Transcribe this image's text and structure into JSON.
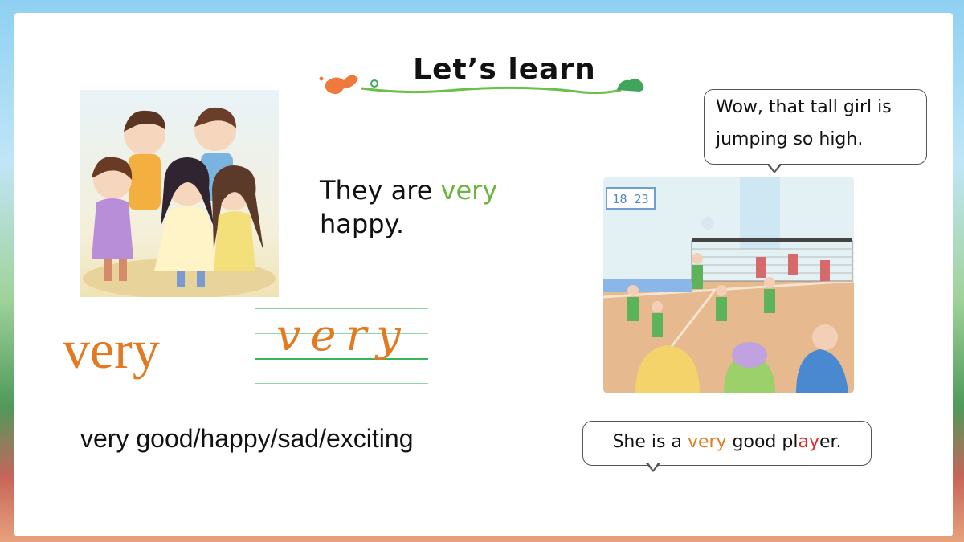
{
  "title": "Let’s learn",
  "sentence1": {
    "before": "They are ",
    "highlight": "very",
    "after": " happy."
  },
  "word_big": "very",
  "word_handwriting": "very",
  "phrases": "very good/happy/sad/exciting",
  "bubble_top": {
    "line1": "Wow, that tall girl is",
    "line2": "jumping so high."
  },
  "bubble_bottom": {
    "p1": "She is a ",
    "p2": "very",
    "p3": " good pl",
    "p4": "ay",
    "p5": "er."
  },
  "scoreboard": "18 23",
  "colors": {
    "accent_green": "#6db33f",
    "accent_orange": "#e27a21",
    "accent_red": "#e02424"
  }
}
